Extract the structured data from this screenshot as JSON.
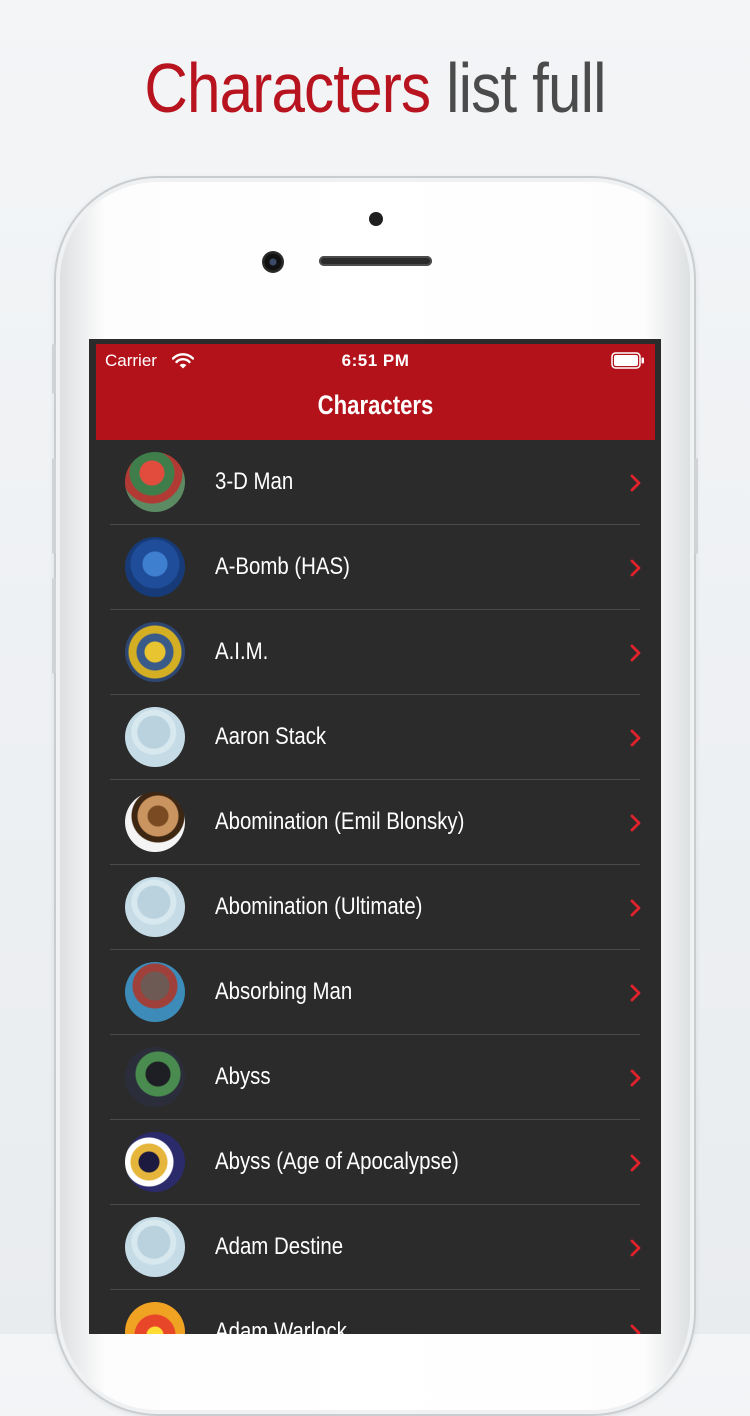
{
  "headline": {
    "accent": "Characters",
    "rest": "list full"
  },
  "status_bar": {
    "carrier": "Carrier",
    "time": "6:51 PM"
  },
  "nav": {
    "title": "Characters"
  },
  "characters": [
    {
      "name": "3-D Man"
    },
    {
      "name": "A-Bomb (HAS)"
    },
    {
      "name": "A.I.M."
    },
    {
      "name": "Aaron Stack"
    },
    {
      "name": "Abomination (Emil Blonsky)"
    },
    {
      "name": "Abomination (Ultimate)"
    },
    {
      "name": "Absorbing Man"
    },
    {
      "name": "Abyss"
    },
    {
      "name": "Abyss (Age of Apocalypse)"
    },
    {
      "name": "Adam Destine"
    },
    {
      "name": "Adam Warlock"
    }
  ],
  "colors": {
    "accent": "#b3121b",
    "list_background": "#2b2b2b",
    "chevron": "#e0222c"
  }
}
